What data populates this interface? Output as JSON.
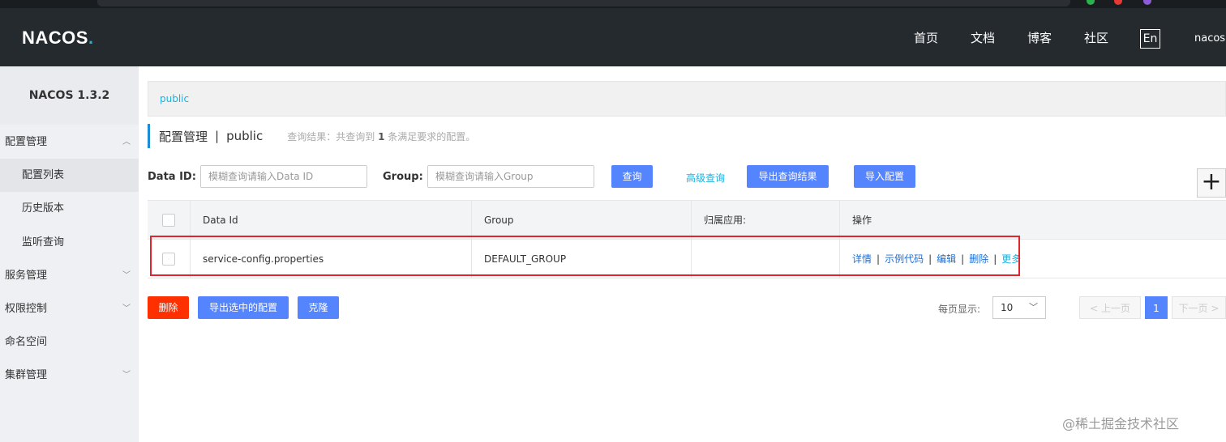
{
  "header": {
    "logo": "NACOS",
    "logo_dot": ".",
    "nav": [
      "首页",
      "文档",
      "博客",
      "社区"
    ],
    "lang": "En",
    "user": "nacos"
  },
  "sidebar": {
    "version": "NACOS 1.3.2",
    "items": [
      {
        "label": "配置管理",
        "expanded": true
      },
      {
        "label": "配置列表",
        "sub": true,
        "active": true
      },
      {
        "label": "历史版本",
        "sub": true
      },
      {
        "label": "监听查询",
        "sub": true
      },
      {
        "label": "服务管理",
        "expanded": false
      },
      {
        "label": "权限控制",
        "expanded": false
      },
      {
        "label": "命名空间"
      },
      {
        "label": "集群管理",
        "expanded": false
      }
    ]
  },
  "breadcrumb": "public",
  "title": {
    "main": "配置管理",
    "sep": "|",
    "namespace": "public",
    "result_prefix": "查询结果：共查询到",
    "result_count": "1",
    "result_suffix": "条满足要求的配置。"
  },
  "search": {
    "dataid_label": "Data ID:",
    "dataid_placeholder": "模糊查询请输入Data ID",
    "group_label": "Group:",
    "group_placeholder": "模糊查询请输入Group",
    "query_btn": "查询",
    "advanced": "高级查询",
    "export_results": "导出查询结果",
    "import_config": "导入配置",
    "add": "+"
  },
  "table": {
    "columns": [
      "Data Id",
      "Group",
      "归属应用:",
      "操作"
    ],
    "rows": [
      {
        "data_id": "service-config.properties",
        "group": "DEFAULT_GROUP",
        "app": ""
      }
    ],
    "ops": [
      "详情",
      "示例代码",
      "编辑",
      "删除",
      "更多"
    ],
    "op_sep": "|"
  },
  "footer": {
    "delete": "删除",
    "export_selected": "导出选中的配置",
    "clone": "克隆",
    "page_size_label": "每页显示:",
    "page_size": "10",
    "prev": "上一页",
    "page": "1",
    "next": "下一页"
  },
  "watermark": "@稀土掘金技术社区",
  "colors": {
    "primary": "#5584ff",
    "danger": "#ff3000",
    "link": "#1bb1e0",
    "header_bg": "#252a2f",
    "highlight": "#e0262d"
  }
}
